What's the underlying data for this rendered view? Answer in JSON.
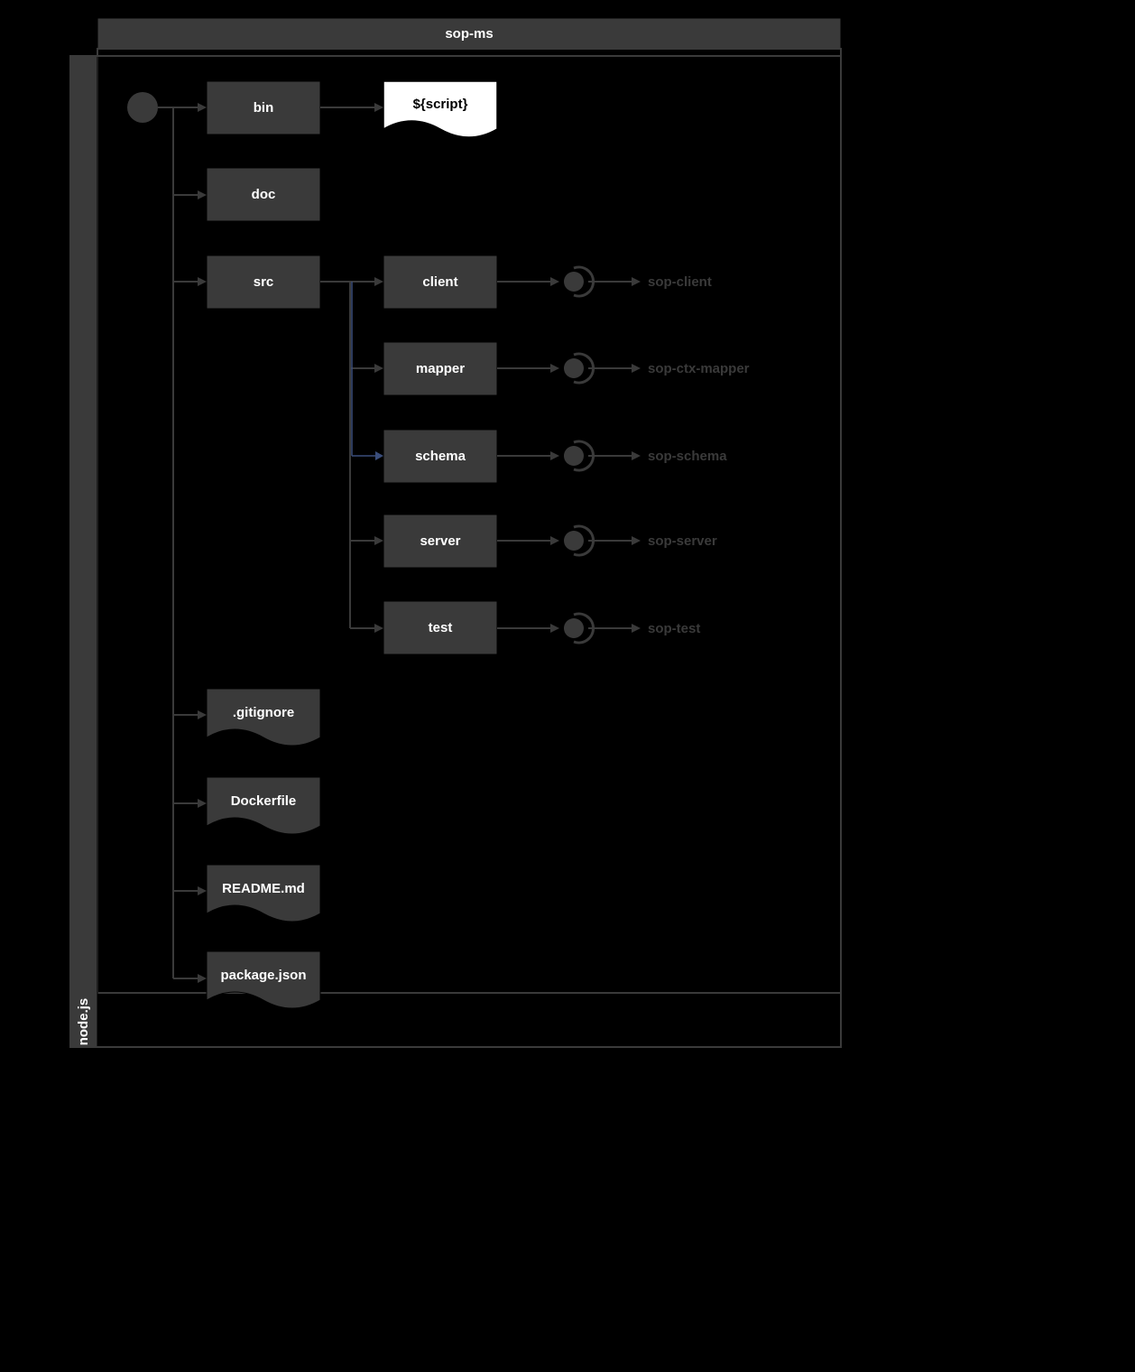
{
  "header": {
    "title": "sop-ms"
  },
  "sidebar": {
    "title": "node.js"
  },
  "nodes": {
    "bin": "bin",
    "doc": "doc",
    "src": "src",
    "script": "${script}",
    "client": "client",
    "mapper": "mapper",
    "schema": "schema",
    "server": "server",
    "test": "test",
    "gitignore": ".gitignore",
    "dockerfile": "Dockerfile",
    "readme": "README.md",
    "packagejson": "package.json"
  },
  "outputs": {
    "client": "sop-client",
    "mapper": "sop-ctx-mapper",
    "schema": "sop-schema",
    "server": "sop-server",
    "test": "sop-test"
  }
}
